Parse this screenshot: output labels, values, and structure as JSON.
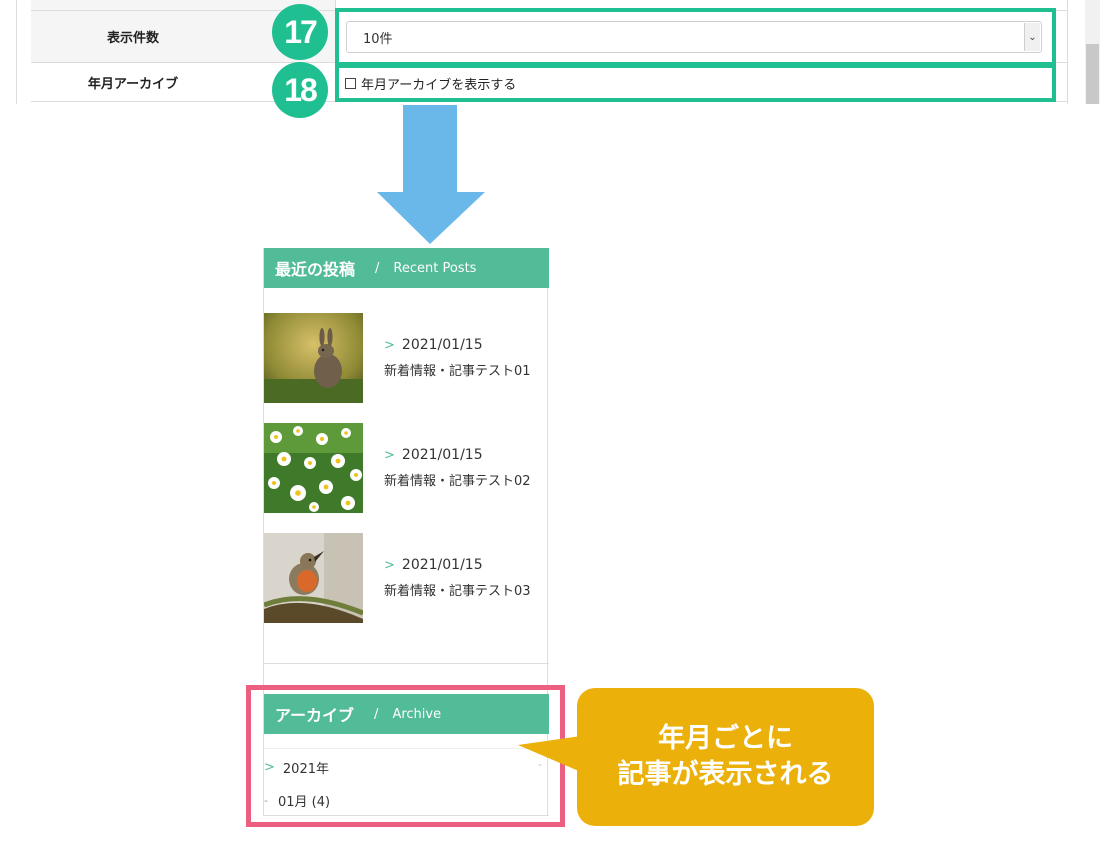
{
  "form": {
    "rows": [
      {
        "label": "表示件数",
        "badge": "17"
      },
      {
        "label": "年月アーカイブ",
        "badge": "18"
      }
    ],
    "select_value": "10件",
    "select_arrow": "⌄",
    "checkbox_label": "年月アーカイブを表示する"
  },
  "sidebar": {
    "recent": {
      "title_ja": "最近の投稿",
      "separator": "/",
      "title_en": "Recent Posts"
    },
    "posts": [
      {
        "date": "2021/01/15",
        "title": "新着情報・記事テスト01",
        "image": "rabbit-photo"
      },
      {
        "date": "2021/01/15",
        "title": "新着情報・記事テスト02",
        "image": "daisy-photo"
      },
      {
        "date": "2021/01/15",
        "title": "新着情報・記事テスト03",
        "image": "robin-photo"
      }
    ],
    "archive": {
      "title_ja": "アーカイブ",
      "separator": "/",
      "title_en": "Archive"
    },
    "archive_items": {
      "year": "2021年",
      "month": "01月 (4)"
    }
  },
  "callout": {
    "line1": "年月ごとに",
    "line2": "記事が表示される"
  },
  "colors": {
    "highlight_green": "#1fbf92",
    "widget_green": "#52bb97",
    "arrow_blue": "#6ab8ea",
    "pink": "#ec5f80",
    "callout_yellow": "#ecb00b"
  }
}
